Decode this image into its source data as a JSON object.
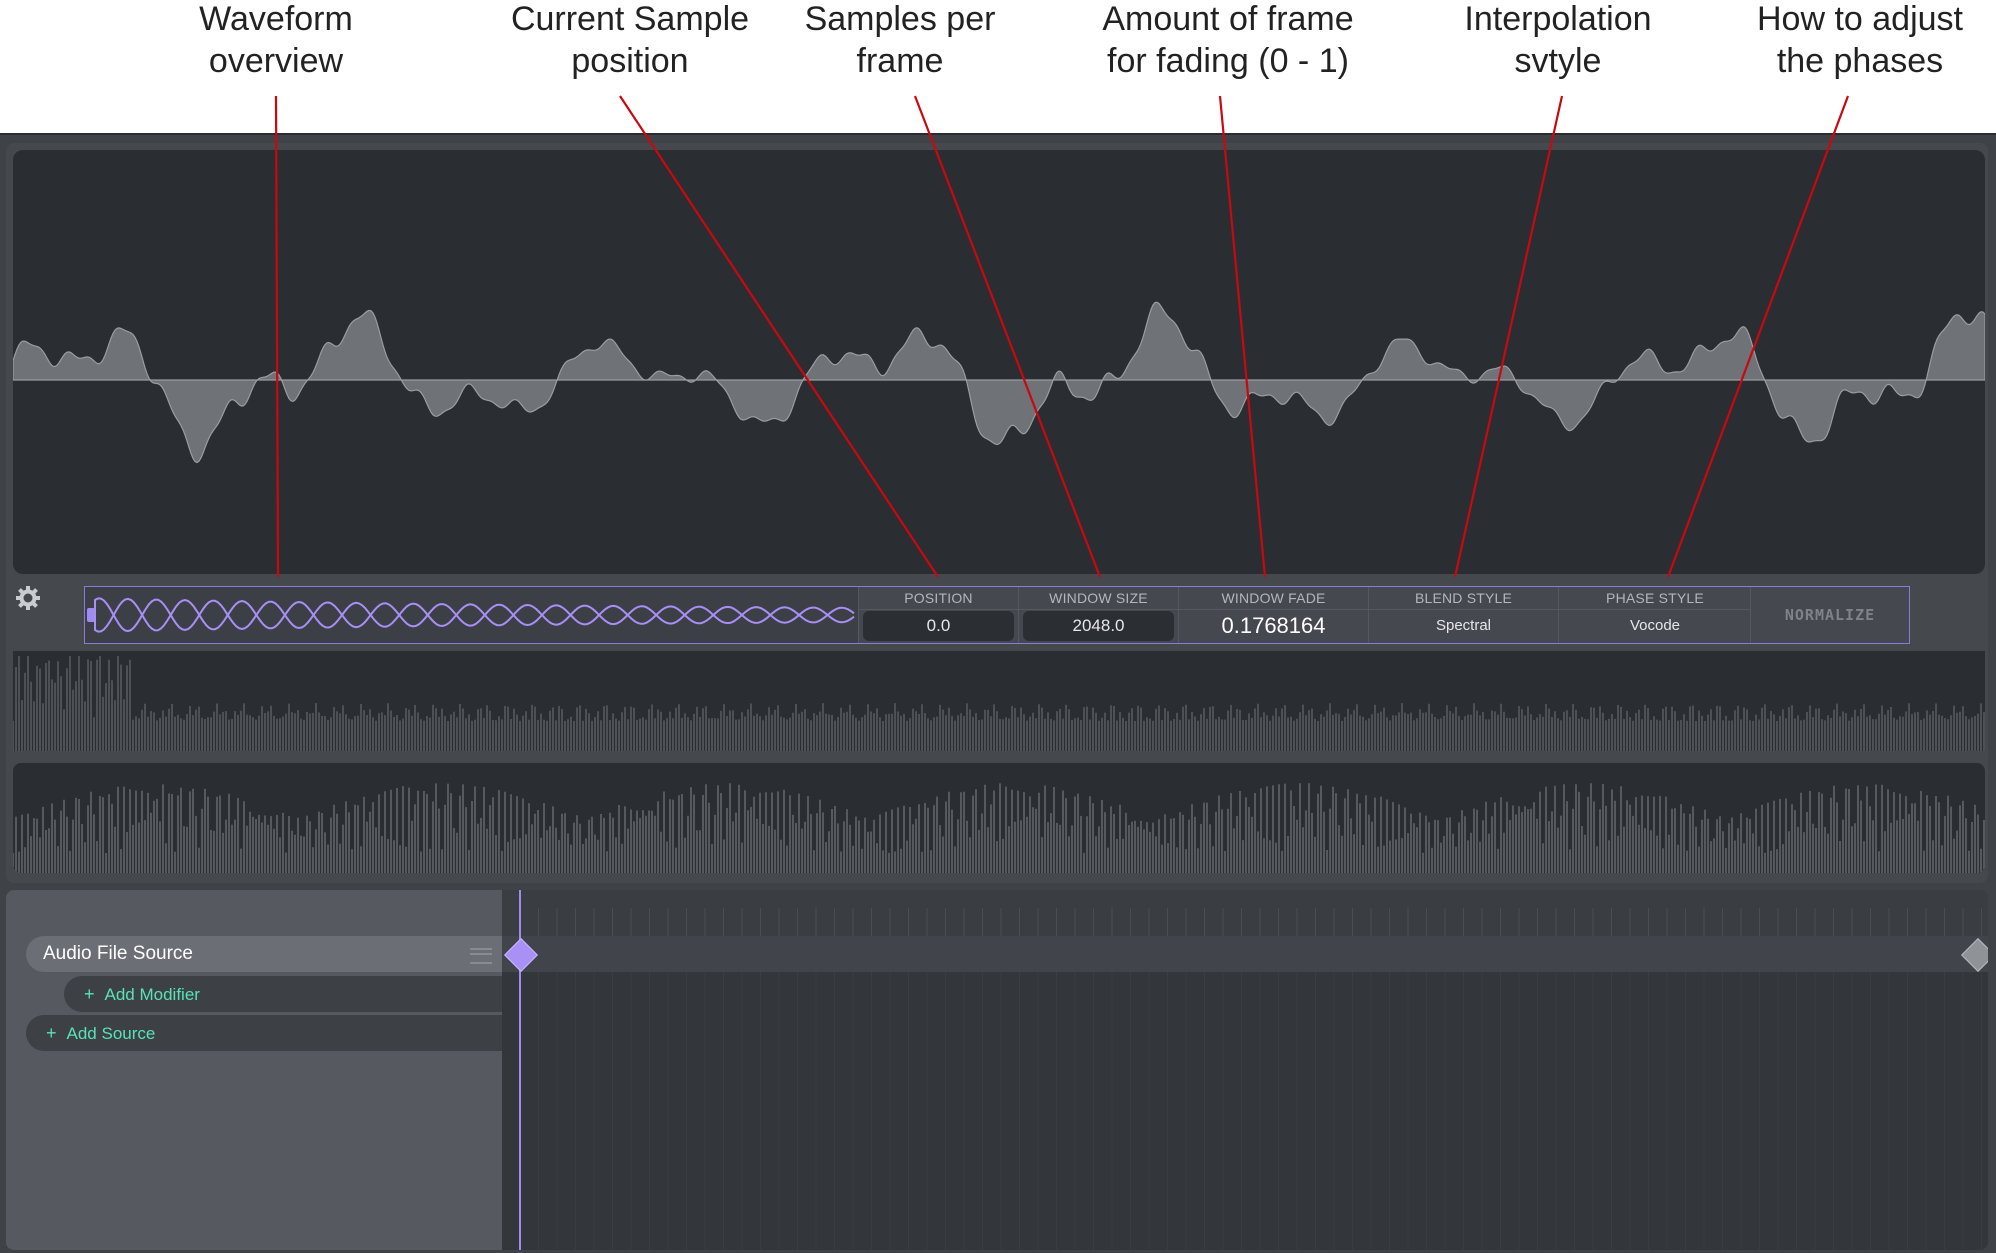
{
  "annotations": [
    {
      "id": "waveform-overview",
      "line1": "Waveform",
      "line2": "overview"
    },
    {
      "id": "current-sample",
      "line1": "Current Sample",
      "line2": "position"
    },
    {
      "id": "samples-per-frame",
      "line1": "Samples per",
      "line2": "frame"
    },
    {
      "id": "fade-amount",
      "line1": "Amount of frame",
      "line2": "for fading (0 - 1)"
    },
    {
      "id": "interpolation",
      "line1": "Interpolation",
      "line2": "svtyle"
    },
    {
      "id": "phases",
      "line1": "How to adjust",
      "line2": "the phases"
    }
  ],
  "toolbar": {
    "position": {
      "label": "POSITION",
      "value": "0.0"
    },
    "window_size": {
      "label": "WINDOW SIZE",
      "value": "2048.0"
    },
    "window_fade": {
      "label": "WINDOW FADE",
      "value": "0.1768164"
    },
    "blend_style": {
      "label": "BLEND STYLE",
      "value": "Spectral"
    },
    "phase_style": {
      "label": "PHASE STYLE",
      "value": "Vocode"
    },
    "normalize_label": "NORMALIZE"
  },
  "sources": {
    "track_label": "Audio File Source",
    "add_modifier_label": "Add Modifier",
    "add_source_label": "Add Source"
  },
  "colors": {
    "accent_purple": "#9f8cf2",
    "add_green": "#57e3b6",
    "annotation_line": "#c8090f",
    "waveform_fill": "#6f7277"
  },
  "icons": {
    "settings": "gear-icon",
    "plus": "plus-icon",
    "drag": "drag-handle-icon",
    "keyframe": "keyframe-diamond-icon"
  }
}
